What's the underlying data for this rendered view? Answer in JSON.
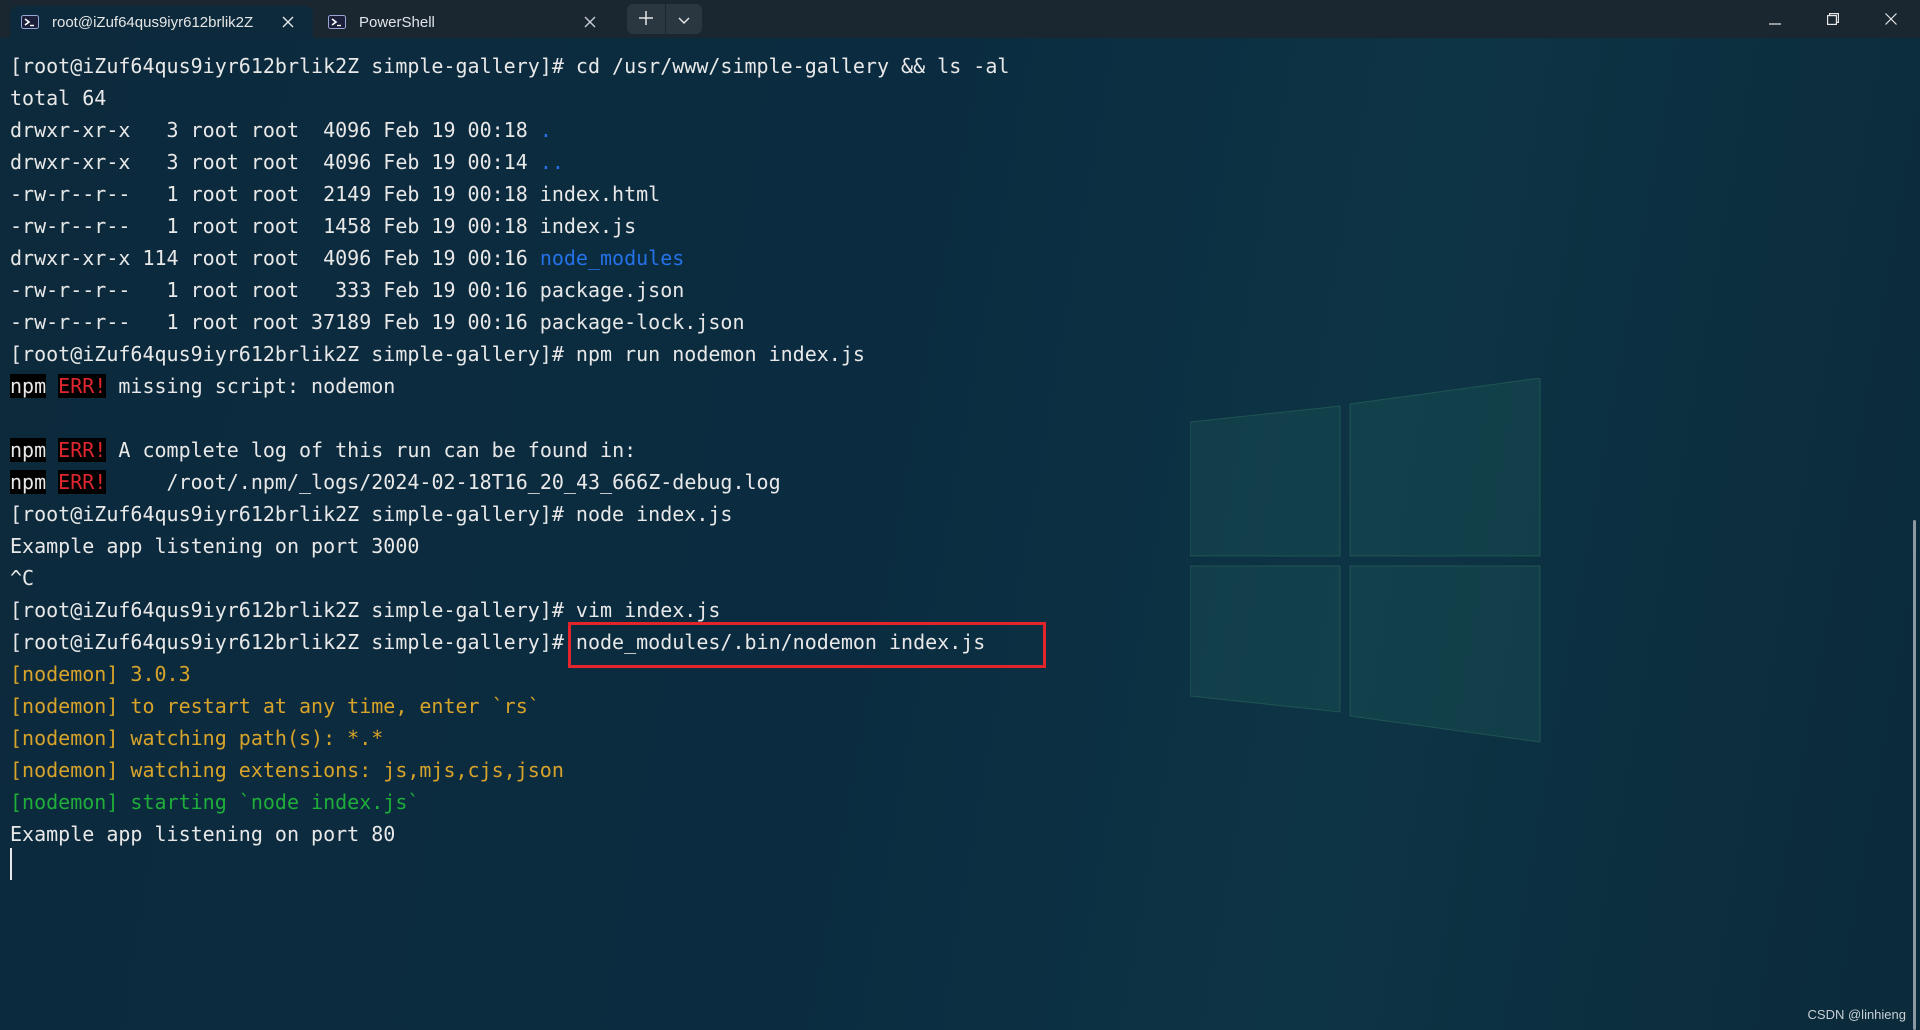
{
  "tabs": [
    {
      "label": "root@iZuf64qus9iyr612brlik2Z",
      "icon": "terminal-icon",
      "active": true
    },
    {
      "label": "PowerShell",
      "icon": "powershell-icon",
      "active": false
    }
  ],
  "controls": {
    "new_tab_icon": "plus-icon",
    "dropdown_icon": "chevron-down-icon",
    "minimize_icon": "minimize-icon",
    "maximize_icon": "restore-icon",
    "close_icon": "close-icon"
  },
  "terminal": {
    "lines": [
      [
        {
          "t": "[root@iZuf64qus9iyr612brlik2Z simple-gallery]# cd /usr/www/simple-gallery && ls -al"
        }
      ],
      [
        {
          "t": "total 64"
        }
      ],
      [
        {
          "t": "drwxr-xr-x   3 root root  4096 Feb 19 00:18 "
        },
        {
          "t": ".",
          "c": "dir"
        }
      ],
      [
        {
          "t": "drwxr-xr-x   3 root root  4096 Feb 19 00:14 "
        },
        {
          "t": "..",
          "c": "dir"
        }
      ],
      [
        {
          "t": "-rw-r--r--   1 root root  2149 Feb 19 00:18 index.html"
        }
      ],
      [
        {
          "t": "-rw-r--r--   1 root root  1458 Feb 19 00:18 index.js"
        }
      ],
      [
        {
          "t": "drwxr-xr-x 114 root root  4096 Feb 19 00:16 "
        },
        {
          "t": "node_modules",
          "c": "dir"
        }
      ],
      [
        {
          "t": "-rw-r--r--   1 root root   333 Feb 19 00:16 package.json"
        }
      ],
      [
        {
          "t": "-rw-r--r--   1 root root 37189 Feb 19 00:16 package-lock.json"
        }
      ],
      [
        {
          "t": "[root@iZuf64qus9iyr612brlik2Z simple-gallery]# npm run nodemon index.js"
        }
      ],
      [
        {
          "t": "npm",
          "c": "npm"
        },
        {
          "t": " "
        },
        {
          "t": "ERR!",
          "c": "err"
        },
        {
          "t": " missing script: nodemon"
        }
      ],
      [],
      [
        {
          "t": "npm",
          "c": "npm"
        },
        {
          "t": " "
        },
        {
          "t": "ERR!",
          "c": "err"
        },
        {
          "t": " A complete log of this run can be found in:"
        }
      ],
      [
        {
          "t": "npm",
          "c": "npm"
        },
        {
          "t": " "
        },
        {
          "t": "ERR!",
          "c": "err"
        },
        {
          "t": "     /root/.npm/_logs/2024-02-18T16_20_43_666Z-debug.log"
        }
      ],
      [
        {
          "t": "[root@iZuf64qus9iyr612brlik2Z simple-gallery]# node index.js"
        }
      ],
      [
        {
          "t": "Example app listening on port 3000"
        }
      ],
      [
        {
          "t": "^C"
        }
      ],
      [
        {
          "t": "[root@iZuf64qus9iyr612brlik2Z simple-gallery]# vim index.js"
        }
      ],
      [
        {
          "t": "[root@iZuf64qus9iyr612brlik2Z simple-gallery]# node_modules/.bin/nodemon index.js"
        }
      ],
      [
        {
          "t": "[nodemon] 3.0.3",
          "c": "warn"
        }
      ],
      [
        {
          "t": "[nodemon] to restart at any time, enter `rs`",
          "c": "warn"
        }
      ],
      [
        {
          "t": "[nodemon] watching path(s): *.*",
          "c": "warn"
        }
      ],
      [
        {
          "t": "[nodemon] watching extensions: js,mjs,cjs,json",
          "c": "warn"
        }
      ],
      [
        {
          "t": "[nodemon] starting `node index.js`",
          "c": "green"
        }
      ],
      [
        {
          "t": "Example app listening on port 80"
        }
      ]
    ]
  },
  "colors": {
    "directory": "#2472e8",
    "nodemon_info": "#d7a32a",
    "nodemon_start": "#1fae3a",
    "error": "#e0272f",
    "highlight_border": "#e3242b"
  },
  "watermark": "CSDN @linhieng"
}
